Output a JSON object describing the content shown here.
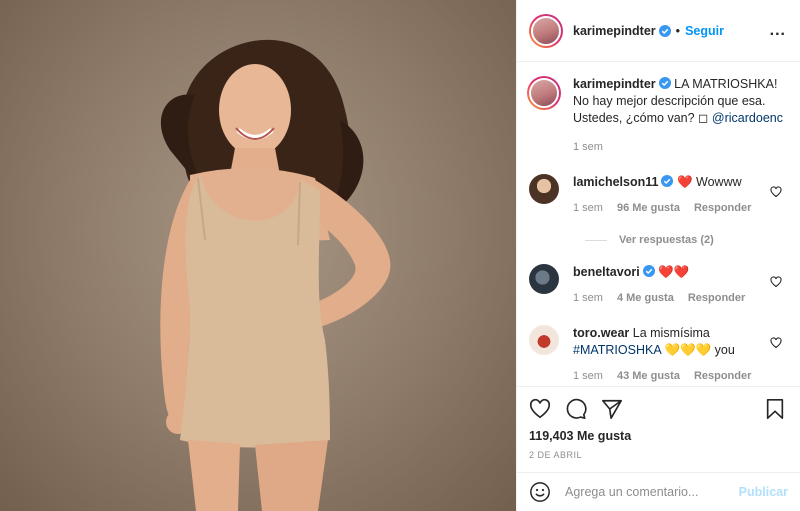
{
  "post": {
    "username": "karimepindter",
    "separator": "•",
    "follow_label": "Seguir",
    "more_label": "..."
  },
  "caption": {
    "username": "karimepindter",
    "text": "LA MATRIOSHKA! No hay mejor descripción que esa. Ustedes, ¿cómo van? ◻",
    "mention": "@ricardoenc",
    "time": "1 sem"
  },
  "comments": [
    {
      "username": "lamichelson11",
      "emoji": "❤️",
      "text": "Wowww",
      "time": "1 sem",
      "likes": "96 Me gusta",
      "reply": "Responder",
      "view_replies": "Ver respuestas (2)"
    },
    {
      "username": "beneltavori",
      "emoji": "❤️❤️",
      "time": "1 sem",
      "likes": "4 Me gusta",
      "reply": "Responder"
    },
    {
      "username": "toro.wear",
      "text": "La mismísima",
      "hashtag": "#MATRIOSHKA",
      "emoji": "💛💛💛",
      "text_after": "you",
      "time": "1 sem",
      "likes": "43 Me gusta",
      "reply": "Responder"
    }
  ],
  "stats": {
    "likes": "119,403 Me gusta",
    "date": "2 DE ABRIL"
  },
  "composer": {
    "placeholder": "Agrega un comentario...",
    "publish_label": "Publicar"
  },
  "icons": [
    "verified-badge-icon",
    "more-options-icon",
    "heart-icon",
    "comment-icon",
    "share-icon",
    "bookmark-icon",
    "emoji-icon"
  ],
  "colors": {
    "link": "#00376b",
    "accent": "#0095f6",
    "muted": "#8e8e8e",
    "heart": "#ed4956"
  }
}
